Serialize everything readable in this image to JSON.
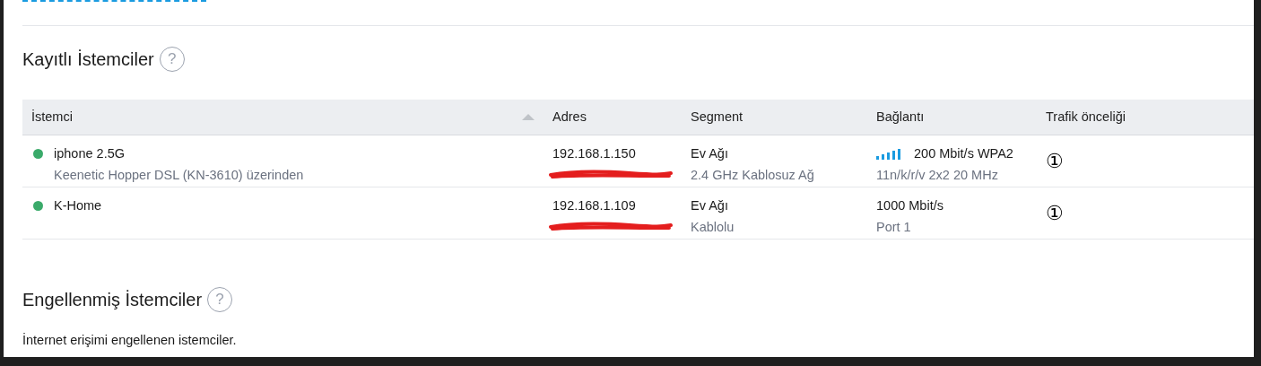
{
  "registered": {
    "title": "Kayıtlı İstemciler",
    "help": "?",
    "columns": [
      {
        "label": "İstemci",
        "sorted": true
      },
      {
        "label": "Adres",
        "sorted": false
      },
      {
        "label": "Segment",
        "sorted": false
      },
      {
        "label": "Bağlantı",
        "sorted": false
      },
      {
        "label": "Trafik önceliği",
        "sorted": false
      }
    ],
    "rows": [
      {
        "online": true,
        "name": "iphone 2.5G",
        "via": "Keenetic Hopper DSL (KN-3610) üzerinden",
        "ip": "192.168.1.150",
        "segment": "Ev Ağı",
        "segment_type": "2.4 GHz Kablosuz Ağ",
        "kind": "wireless",
        "speed": "200 Mbit/s WPA2",
        "link_detail": "11n/k/r/v 2x2 20 MHz",
        "priority": "①"
      },
      {
        "online": true,
        "name": "K-Home",
        "ip": "192.168.1.109",
        "segment": "Ev Ağı",
        "segment_type": "Kablolu",
        "kind": "wired",
        "speed": "1000 Mbit/s",
        "link_detail": "Port 1",
        "priority": "①"
      }
    ]
  },
  "blocked": {
    "title": "Engellenmiş İstemciler",
    "help": "?",
    "description": "İnternet erişimi engellenen istemciler."
  }
}
